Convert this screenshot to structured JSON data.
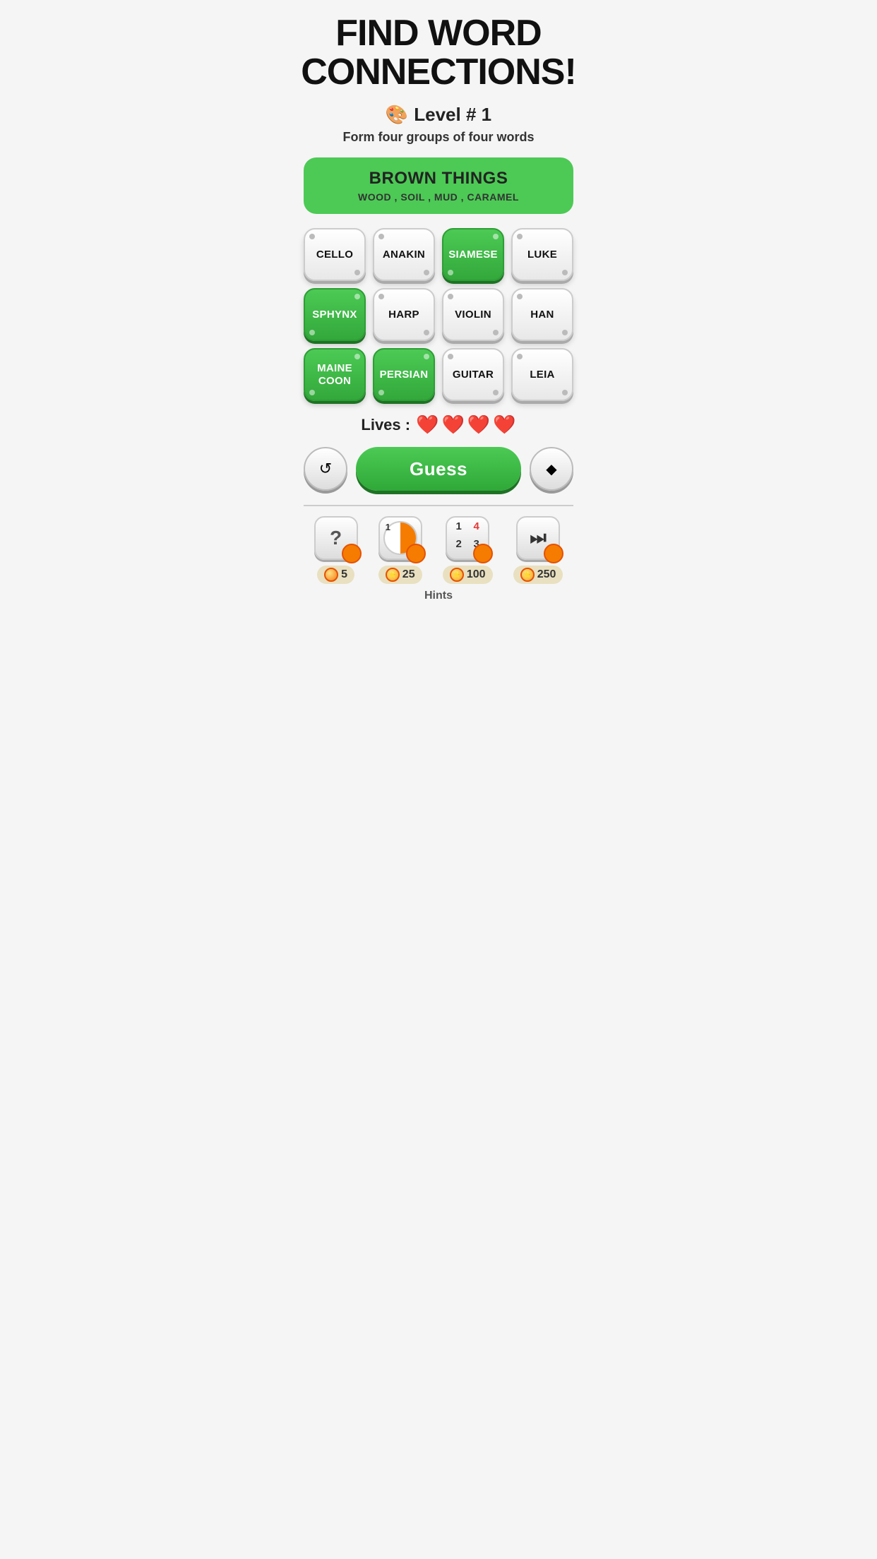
{
  "header": {
    "title": "FIND WORD\nCONNECTIONS!"
  },
  "level": {
    "icon": "🎨",
    "label": "Level # 1"
  },
  "subtitle": "Form four groups of four words",
  "solved_group": {
    "title": "BROWN THINGS",
    "words": "WOOD , SOIL , MUD , CARAMEL"
  },
  "grid": [
    {
      "word": "CELLO",
      "selected": false
    },
    {
      "word": "ANAKIN",
      "selected": false
    },
    {
      "word": "SIAMESE",
      "selected": true
    },
    {
      "word": "LUKE",
      "selected": false
    },
    {
      "word": "SPHYNX",
      "selected": true
    },
    {
      "word": "HARP",
      "selected": false
    },
    {
      "word": "VIOLIN",
      "selected": false
    },
    {
      "word": "HAN",
      "selected": false
    },
    {
      "word": "MAINE\nCOON",
      "selected": true
    },
    {
      "word": "PERSIAN",
      "selected": true
    },
    {
      "word": "GUITAR",
      "selected": false
    },
    {
      "word": "LEIA",
      "selected": false
    }
  ],
  "lives": {
    "label": "Lives :",
    "count": 4
  },
  "buttons": {
    "shuffle": "↺",
    "guess": "Guess",
    "erase": "◆"
  },
  "hints": [
    {
      "type": "question",
      "cost": "5"
    },
    {
      "type": "pie",
      "cost": "25"
    },
    {
      "type": "numbers",
      "cost": "100"
    },
    {
      "type": "play",
      "cost": "250"
    }
  ],
  "hints_label": "Hints"
}
